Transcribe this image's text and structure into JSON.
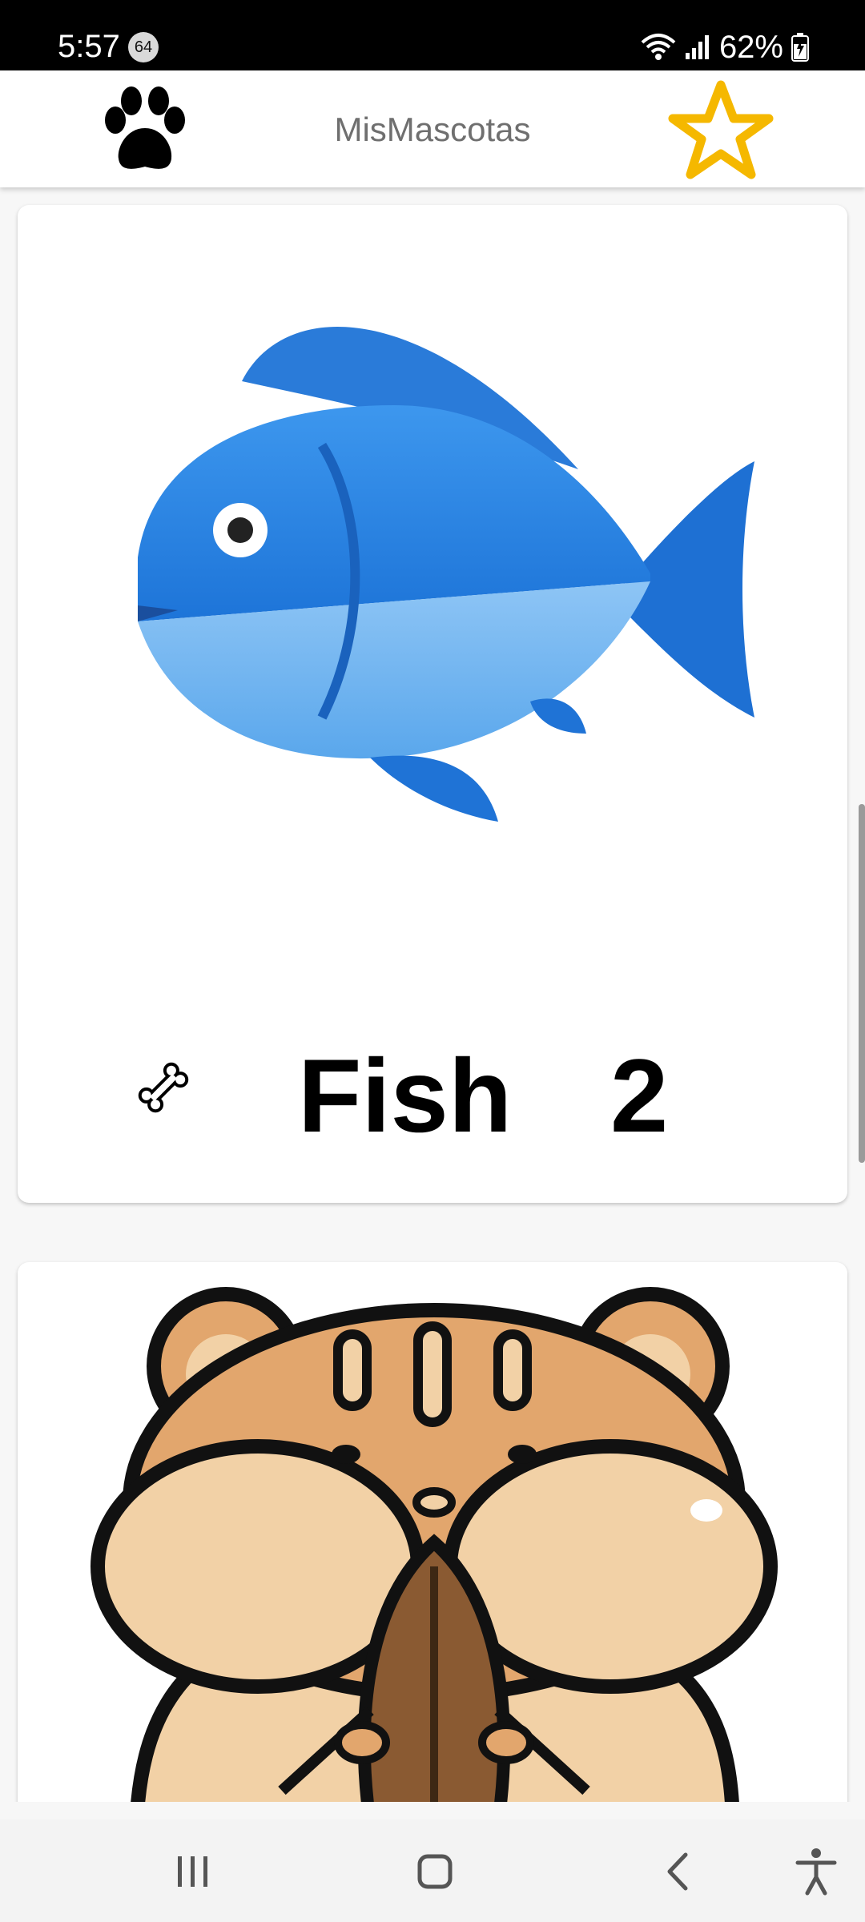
{
  "status_bar": {
    "time": "5:57",
    "notification_badge": "64",
    "battery": "62%",
    "icons": [
      "wifi-icon",
      "signal-icon",
      "battery-icon"
    ]
  },
  "app_bar": {
    "title": "MisMascotas",
    "left_icon": "paw-icon",
    "right_icon": "star-icon",
    "star_color": "#F5B800"
  },
  "pets": [
    {
      "name": "Fish",
      "count": "2",
      "image": "fish-image",
      "action_icon": "bone-icon"
    },
    {
      "image": "hamster-image"
    }
  ],
  "nav_bar": {
    "buttons": [
      "recent-apps-icon",
      "home-icon",
      "back-icon",
      "accessibility-icon"
    ]
  }
}
